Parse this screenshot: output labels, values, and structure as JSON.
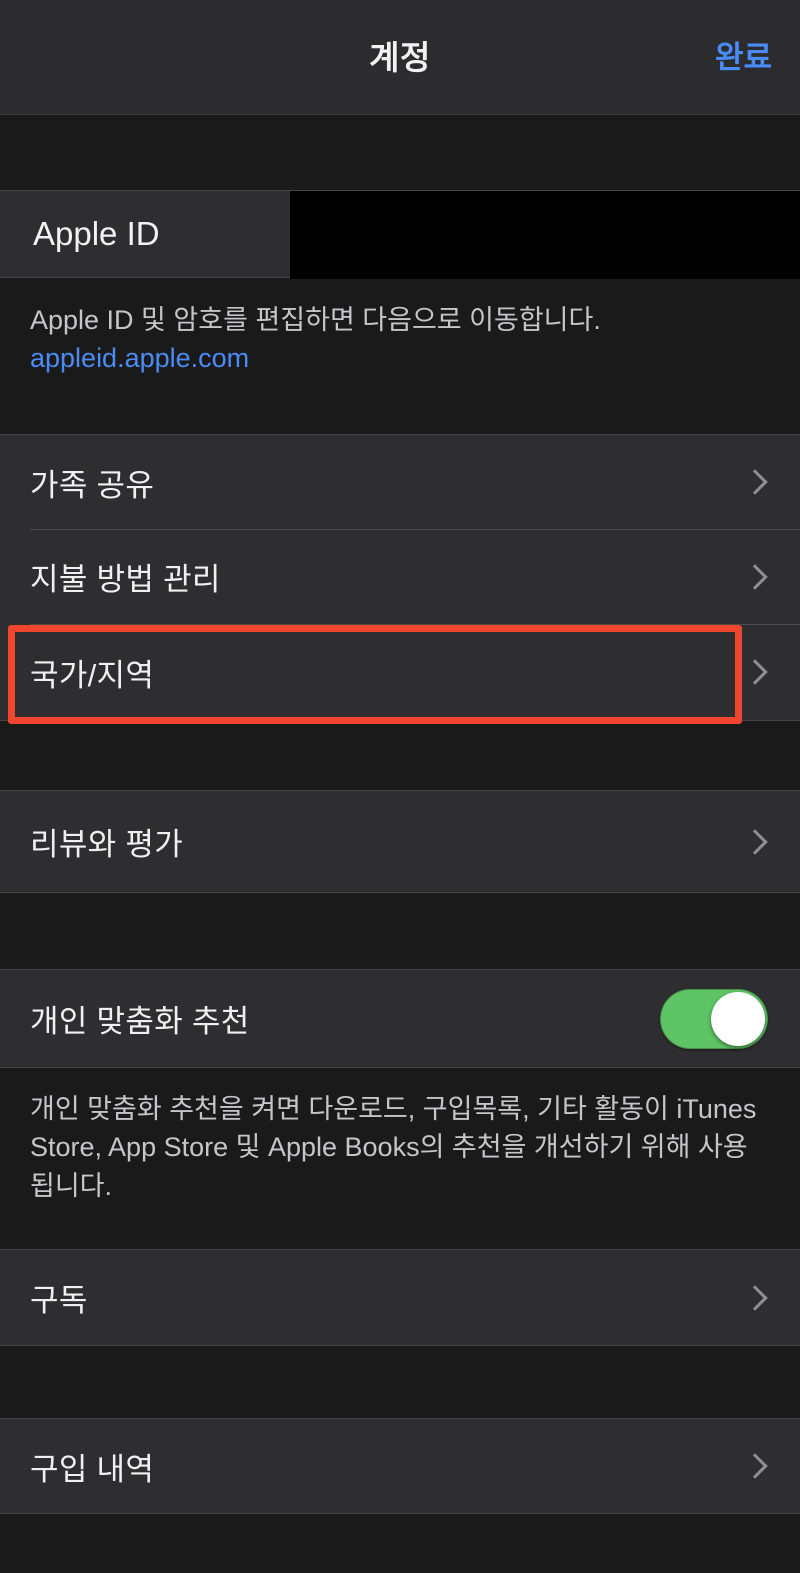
{
  "navbar": {
    "title": "계정",
    "done_label": "완료"
  },
  "apple_id_section": {
    "label": "Apple ID",
    "value_redacted": true,
    "footer_text": "Apple ID 및 암호를 편집하면 다음으로 이동합니다.",
    "footer_link": "appleid.apple.com"
  },
  "account_group": {
    "items": [
      {
        "label": "가족 공유",
        "accessory": "chevron-right-icon"
      },
      {
        "label": "지불 방법 관리",
        "accessory": "chevron-right-icon"
      },
      {
        "label": "국가/지역",
        "accessory": "chevron-right-icon",
        "highlighted": true
      }
    ]
  },
  "reviews_group": {
    "items": [
      {
        "label": "리뷰와 평가",
        "accessory": "chevron-right-icon"
      }
    ]
  },
  "personalization_group": {
    "label": "개인 맞춤화 추천",
    "toggle_state": "on",
    "footer_text": "개인 맞춤화 추천을 켜면 다운로드, 구입목록, 기타 활동이 iTunes Store, App Store 및 Apple Books의 추천을 개선하기 위해 사용됩니다."
  },
  "subscriptions_group": {
    "items": [
      {
        "label": "구독",
        "accessory": "chevron-right-icon"
      }
    ]
  },
  "purchase_history_group": {
    "items": [
      {
        "label": "구입 내역",
        "accessory": "chevron-right-icon"
      }
    ]
  },
  "colors": {
    "accent_blue": "#4a8cf7",
    "toggle_green": "#5fc466",
    "annotation_red": "#f0452e",
    "row_background": "#2e2e30",
    "page_background": "#1a1a1b"
  }
}
